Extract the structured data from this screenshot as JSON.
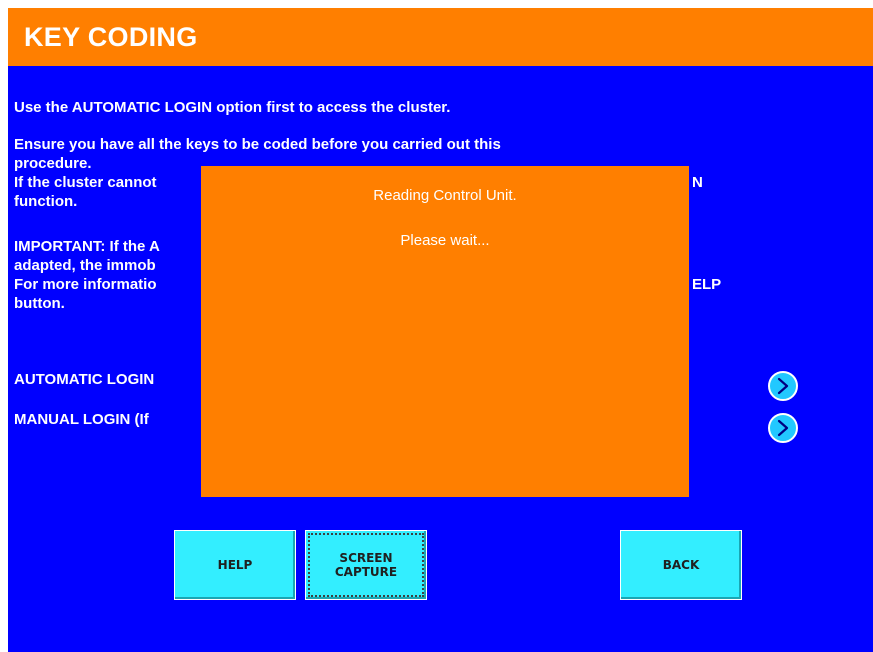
{
  "header": {
    "title": "KEY CODING"
  },
  "instructions": {
    "p1": "Use the AUTOMATIC LOGIN option first to access the cluster.",
    "p2_line1": "Ensure you have all the keys to be coded before you carried out this",
    "p2_line2": "procedure.",
    "p2_line3a": "If the cluster cannot",
    "p2_line3b": "N",
    "p2_line4": "function.",
    "p3_line1": "IMPORTANT: If the A",
    "p3_line2": "adapted, the immob",
    "p3_line3a": "For more informatio",
    "p3_line3b": "ELP",
    "p3_line4": "button."
  },
  "options": {
    "automatic_login": "AUTOMATIC LOGIN",
    "manual_login": "MANUAL LOGIN   (If"
  },
  "dialog": {
    "line1": "Reading Control Unit.",
    "line2": "Please wait..."
  },
  "buttons": {
    "help": "HELP",
    "screen_capture_line1": "SCREEN",
    "screen_capture_line2": "CAPTURE",
    "back": "BACK"
  },
  "icons": {
    "automatic_login_arrow": "chevron-right-icon",
    "manual_login_arrow": "chevron-right-icon"
  },
  "colors": {
    "background": "#0000ff",
    "header": "#ff7f00",
    "dialog": "#ff7f00",
    "button": "#33eeff",
    "arrow": "#22c8ff"
  }
}
